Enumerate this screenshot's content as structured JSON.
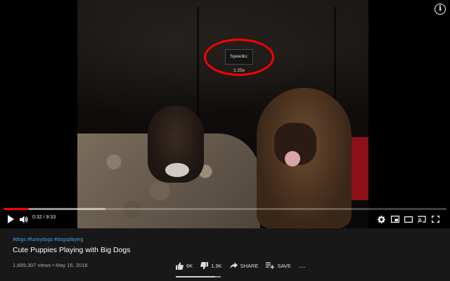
{
  "player": {
    "speed_badge": "Speedio: 2.25x",
    "time_display": "0:32 / 9:33",
    "progress": {
      "played_fraction": 0.057,
      "loaded_fraction": 0.23
    },
    "colors": {
      "progress_played": "#ff0000",
      "annotation_circle": "#ff0000"
    },
    "controls": [
      "play-icon",
      "volume-icon",
      "settings-icon",
      "miniplayer-icon",
      "theater-mode-icon",
      "cast-icon",
      "fullscreen-icon"
    ],
    "corner_icon": "i"
  },
  "video": {
    "hashtags": "#dogs #funnydogs #dogsplaying",
    "title": "Cute Puppies Playing with Big Dogs",
    "meta": "1,689,307 views • May 16, 2018",
    "likes": "6K",
    "dislikes": "1.9K",
    "share_label": "SHARE",
    "save_label": "SAVE",
    "more_label": "..."
  }
}
